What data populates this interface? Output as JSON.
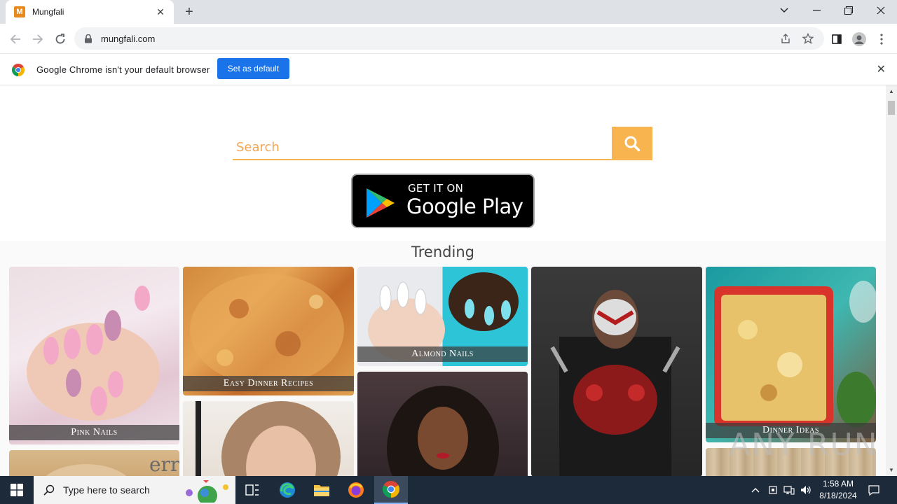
{
  "browser": {
    "tab_title": "Mungfali",
    "tab_favicon_letter": "M",
    "url": "mungfali.com",
    "window_controls": {
      "minimize": "—",
      "restore": "❐",
      "close": "✕"
    }
  },
  "infobar": {
    "message": "Google Chrome isn't your default browser",
    "button_label": "Set as default"
  },
  "page": {
    "search": {
      "placeholder": "Search"
    },
    "play_badge": {
      "small_text": "GET IT ON",
      "big_text": "Google Play"
    },
    "trending_title": "Trending",
    "cards": [
      {
        "label": "Pink Nails"
      },
      {
        "label": "Easy Dinner Recipes"
      },
      {
        "label": "Almond Nails"
      },
      {
        "label": ""
      },
      {
        "label": "Dinner Ideas"
      },
      {
        "label": ""
      },
      {
        "label": ""
      },
      {
        "label": ""
      }
    ]
  },
  "watermark": "ANY RUN",
  "taskbar": {
    "search_placeholder": "Type here to search",
    "time": "1:58 AM",
    "date": "8/18/2024"
  },
  "colors": {
    "accent_orange": "#f7b44f",
    "chrome_blue": "#1a73e8",
    "taskbar": "#1c2a3a"
  }
}
